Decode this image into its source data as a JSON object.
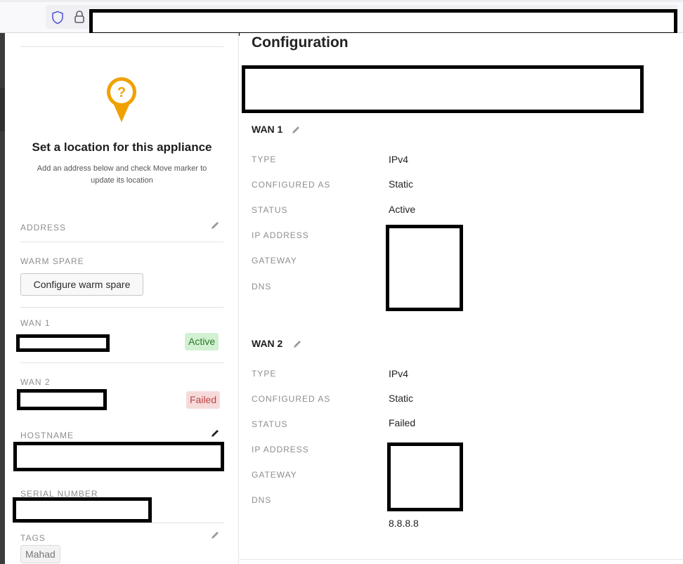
{
  "browser": {
    "url_redacted": true
  },
  "sidebar": {
    "location": {
      "title": "Set a location for this appliance",
      "subtitle": "Add an address below and check Move marker to update its location",
      "icon": "question-map-pin-icon",
      "icon_color": "#f0a100"
    },
    "address": {
      "label": "ADDRESS"
    },
    "warm_spare": {
      "label": "WARM SPARE",
      "button_label": "Configure warm spare"
    },
    "wan1": {
      "label": "WAN 1",
      "status": "Active",
      "status_color": "#2a7a2a"
    },
    "wan2": {
      "label": "WAN 2",
      "status": "Failed",
      "status_color": "#b44444"
    },
    "hostname": {
      "label": "HOSTNAME"
    },
    "serial_number": {
      "label": "SERIAL NUMBER"
    },
    "tags": {
      "label": "TAGS",
      "items": [
        "Mahad"
      ]
    }
  },
  "main": {
    "title": "Configuration",
    "wan1": {
      "heading": "WAN 1",
      "rows": [
        {
          "label": "TYPE",
          "value": "IPv4"
        },
        {
          "label": "CONFIGURED AS",
          "value": "Static"
        },
        {
          "label": "STATUS",
          "value": "Active"
        },
        {
          "label": "IP ADDRESS",
          "value": ""
        },
        {
          "label": "GATEWAY",
          "value": ""
        },
        {
          "label": "DNS",
          "value": ""
        }
      ]
    },
    "wan2": {
      "heading": "WAN 2",
      "rows": [
        {
          "label": "TYPE",
          "value": "IPv4"
        },
        {
          "label": "CONFIGURED AS",
          "value": "Static"
        },
        {
          "label": "STATUS",
          "value": "Failed"
        },
        {
          "label": "IP ADDRESS",
          "value": ""
        },
        {
          "label": "GATEWAY",
          "value": ""
        },
        {
          "label": "DNS",
          "value": ""
        }
      ],
      "dns_secondary": "8.8.8.8"
    }
  }
}
